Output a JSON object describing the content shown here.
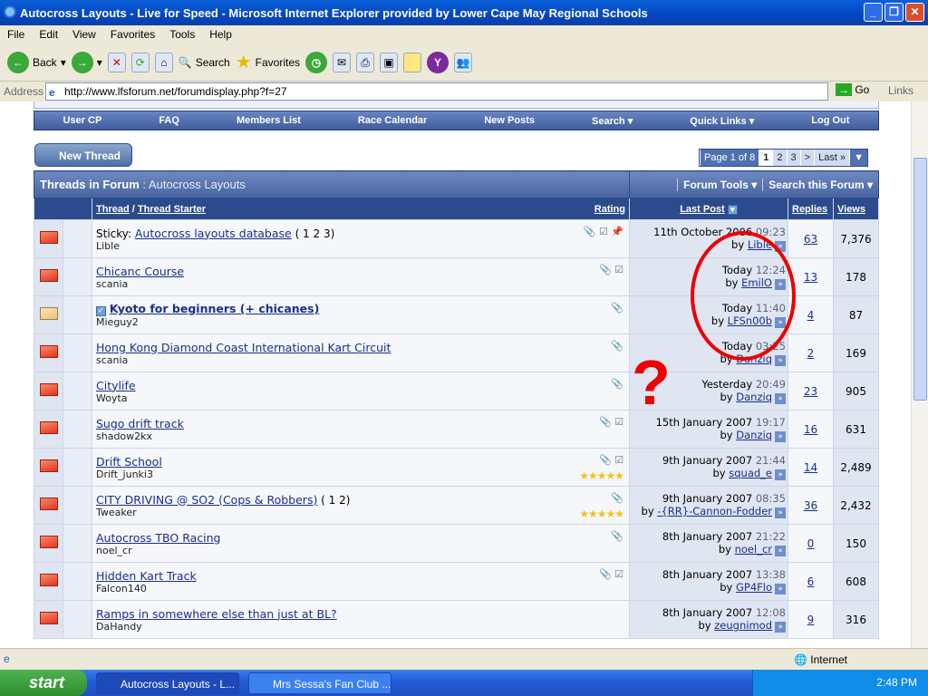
{
  "window": {
    "title": "Autocross Layouts - Live for Speed - Microsoft Internet Explorer provided by Lower Cape May Regional Schools"
  },
  "menu": [
    "File",
    "Edit",
    "View",
    "Favorites",
    "Tools",
    "Help"
  ],
  "toolbar": {
    "back": "Back",
    "search": "Search",
    "favorites": "Favorites"
  },
  "address": {
    "label": "Address",
    "url": "http://www.lfsforum.net/forumdisplay.php?f=27",
    "go": "Go",
    "links": "Links"
  },
  "nav": [
    "User CP",
    "FAQ",
    "Members List",
    "Race Calendar",
    "New Posts",
    "Search ▾",
    "Quick Links ▾",
    "Log Out"
  ],
  "new_thread": "New Thread",
  "pager": {
    "label": "Page 1 of 8",
    "pages": [
      "1",
      "2",
      "3"
    ],
    "next": ">",
    "last": "Last »"
  },
  "forum": {
    "heading": "Threads in Forum",
    "name": ": Autocross Layouts",
    "tools": "Forum Tools ▾",
    "search": "Search this Forum ▾"
  },
  "columns": {
    "thread": "Thread",
    "sep": " / ",
    "starter": "Thread Starter",
    "rating": "Rating",
    "last_post": "Last Post",
    "replies": "Replies",
    "views": "Views"
  },
  "threads": [
    {
      "prefix": "Sticky: ",
      "title": "Autocross layouts database",
      "pages": "( 1 2 3)",
      "starter": "Lible",
      "icons": "📎 ☑ 📌",
      "date": "11th October 2006",
      "time": "09:23",
      "by": "Lible",
      "replies": "63",
      "views": "7,376"
    },
    {
      "title": "Chicanc Course",
      "starter": "scania",
      "icons": "📎 ☑",
      "date": "Today",
      "time": "12:24",
      "by": "EmilO",
      "replies": "13",
      "views": "178"
    },
    {
      "title": "Kyoto for beginners (+ chicanes)",
      "bold": true,
      "starter": "Mieguy2",
      "icons": "📎",
      "date": "Today",
      "time": "11:40",
      "by": "LFSn00b",
      "replies": "4",
      "views": "87"
    },
    {
      "title": "Hong Kong Diamond Coast International Kart Circuit",
      "starter": "scania",
      "icons": "📎",
      "date": "Today",
      "time": "03:25",
      "by": "Danziq",
      "replies": "2",
      "views": "169"
    },
    {
      "title": "Citylife",
      "starter": "Woyta",
      "icons": "📎",
      "date": "Yesterday",
      "time": "20:49",
      "by": "Danziq",
      "replies": "23",
      "views": "905"
    },
    {
      "title": "Sugo drift track",
      "starter": "shadow2kx",
      "icons": "📎 ☑",
      "date": "15th January 2007",
      "time": "19:17",
      "by": "Danziq",
      "replies": "16",
      "views": "631"
    },
    {
      "title": "Drift School",
      "starter": "Drift_junki3",
      "icons": "📎 ☑",
      "stars": "★★★★★",
      "date": "9th January 2007",
      "time": "21:44",
      "by": "squad_e",
      "replies": "14",
      "views": "2,489"
    },
    {
      "title": "CITY DRIVING @ SO2 (Cops & Robbers)",
      "pages": "( 1 2)",
      "starter": "Tweaker",
      "icons": "📎",
      "stars": "★★★★★",
      "date": "9th January 2007",
      "time": "08:35",
      "by": "-{RR}-Cannon-Fodder",
      "replies": "36",
      "views": "2,432"
    },
    {
      "title": "Autocross TBO Racing",
      "starter": "noel_cr",
      "icons": "📎",
      "date": "8th January 2007",
      "time": "21:22",
      "by": "noel_cr",
      "replies": "0",
      "views": "150"
    },
    {
      "title": "Hidden Kart Track",
      "starter": "Falcon140",
      "icons": "📎 ☑",
      "date": "8th January 2007",
      "time": "13:38",
      "by": "GP4Flo",
      "replies": "6",
      "views": "608"
    },
    {
      "title": "Ramps in somewhere else than just at BL?",
      "starter": "DaHandy",
      "icons": "",
      "date": "8th January 2007",
      "time": "12:08",
      "by": "zeugnimod",
      "replies": "9",
      "views": "316"
    }
  ],
  "annotation": "?",
  "status": {
    "zone": "Internet"
  },
  "taskbar": {
    "start": "start",
    "tasks": [
      "Autocross Layouts - L...",
      "Mrs Sessa's Fan Club ..."
    ],
    "clock": "2:48 PM"
  }
}
